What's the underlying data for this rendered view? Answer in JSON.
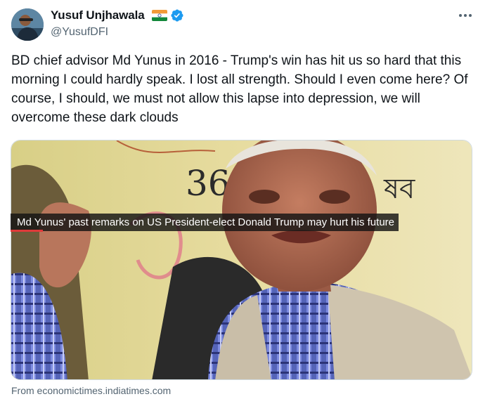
{
  "author": {
    "display_name": "Yusuf Unjhawala",
    "handle": "@YusufDFI",
    "flag_icon": "india-flag-icon",
    "verified_icon": "verified-badge-icon",
    "verified_color": "#1d9bf0"
  },
  "tweet": {
    "text": "BD chief advisor Md Yunus in 2016 - Trump's win has hit us so hard that this morning I could hardly speak. I lost all strength. Should I even come here? Of course, I should, we must not allow this lapse into depression, we will overcome these dark clouds"
  },
  "media": {
    "caption": "Md Yunus' past remarks on US President-elect Donald Trump may hurt his future",
    "board_text_left": "36",
    "board_text_right": "ষব"
  },
  "card": {
    "source": "From economictimes.indiatimes.com"
  },
  "colors": {
    "text": "#0f1419",
    "secondary": "#536471",
    "caption_accent": "#e03a3a"
  }
}
